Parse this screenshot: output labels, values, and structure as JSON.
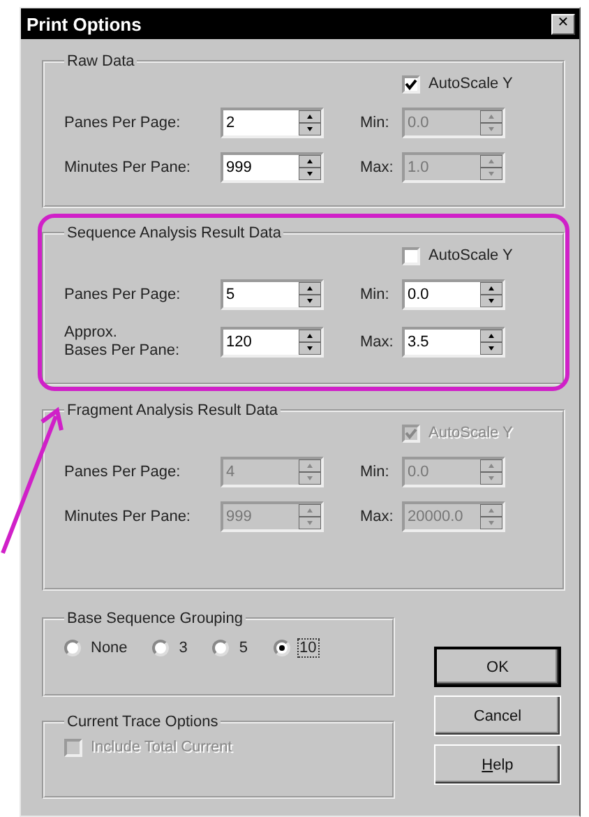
{
  "window": {
    "title": "Print Options",
    "close_symbol": "✕"
  },
  "groups": [
    {
      "title": "Raw Data",
      "highlighted": false,
      "tall": false,
      "autoscale": {
        "label": "AutoScale Y",
        "checked": true,
        "disabled": false
      },
      "left": [
        {
          "label": "Panes Per Page:",
          "value": "2",
          "disabled": false
        },
        {
          "label": "Minutes Per Pane:",
          "value": "999",
          "disabled": false
        }
      ],
      "right": [
        {
          "label": "Min:",
          "value": "0.0",
          "disabled": true
        },
        {
          "label": "Max:",
          "value": "1.0",
          "disabled": true
        }
      ]
    },
    {
      "title": "Sequence Analysis Result Data",
      "highlighted": true,
      "tall": false,
      "autoscale": {
        "label": "AutoScale Y",
        "checked": false,
        "disabled": false
      },
      "left": [
        {
          "label": "Panes Per Page:",
          "value": "5",
          "disabled": false
        },
        {
          "label": "Approx.\nBases Per Pane:",
          "value": "120",
          "disabled": false
        }
      ],
      "right": [
        {
          "label": "Min:",
          "value": "0.0",
          "disabled": false
        },
        {
          "label": "Max:",
          "value": "3.5",
          "disabled": false
        }
      ]
    },
    {
      "title": "Fragment Analysis Result Data",
      "highlighted": false,
      "tall": true,
      "autoscale": {
        "label": "AutoScale Y",
        "checked": true,
        "disabled": true
      },
      "left": [
        {
          "label": "Panes Per Page:",
          "value": "4",
          "disabled": true
        },
        {
          "label": "Minutes Per Pane:",
          "value": "999",
          "disabled": true
        }
      ],
      "right": [
        {
          "label": "Min:",
          "value": "0.0",
          "disabled": true
        },
        {
          "label": "Max:",
          "value": "20000.0",
          "disabled": true
        }
      ]
    }
  ],
  "grouping": {
    "title": "Base Sequence Grouping",
    "options": [
      {
        "label": "None",
        "selected": false
      },
      {
        "label": "3",
        "selected": false
      },
      {
        "label": "5",
        "selected": false
      },
      {
        "label": "10",
        "selected": true
      }
    ]
  },
  "trace": {
    "title": "Current Trace Options",
    "option": {
      "label": "Include Total Current",
      "checked": false,
      "disabled": true
    }
  },
  "buttons": [
    {
      "label": "OK",
      "default": true
    },
    {
      "label": "Cancel",
      "default": false
    },
    {
      "label": "Help",
      "default": false,
      "underline_first": true
    }
  ]
}
